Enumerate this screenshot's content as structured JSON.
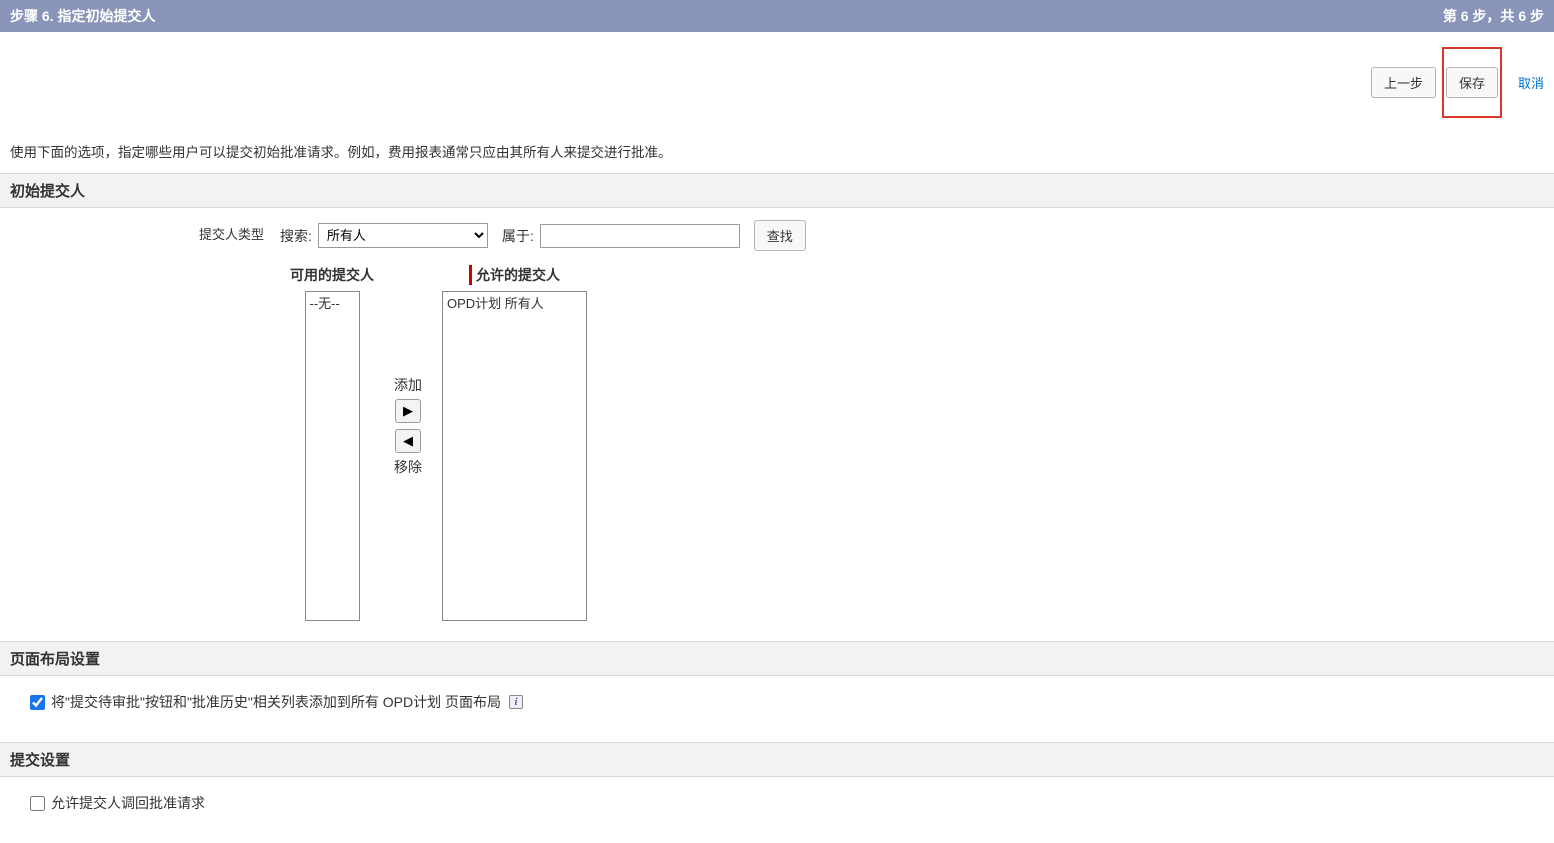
{
  "header": {
    "title": "步骤 6. 指定初始提交人",
    "step_indicator": "第 6 步，共 6 步"
  },
  "actions": {
    "previous": "上一步",
    "save": "保存",
    "cancel": "取消"
  },
  "description": "使用下面的选项，指定哪些用户可以提交初始批准请求。例如，费用报表通常只应由其所有人来提交进行批准。",
  "sections": {
    "initial_submitter": "初始提交人",
    "page_layout": "页面布局设置",
    "submit_settings": "提交设置"
  },
  "submitter_type": {
    "label": "提交人类型",
    "search_label": "搜索:",
    "search_selected": "所有人",
    "belongs_label": "属于:",
    "belongs_value": "",
    "find_button": "查找"
  },
  "duellist": {
    "available_header": "可用的提交人",
    "allowed_header": "允许的提交人",
    "available_items": [
      "--无--"
    ],
    "allowed_items": [
      "OPD计划 所有人"
    ],
    "add_label": "添加",
    "remove_label": "移除"
  },
  "page_layout_checkbox": {
    "label": "将\"提交待审批\"按钮和\"批准历史\"相关列表添加到所有 OPD计划 页面布局",
    "checked": true
  },
  "submit_settings_checkbox": {
    "label": "允许提交人调回批准请求",
    "checked": false
  }
}
